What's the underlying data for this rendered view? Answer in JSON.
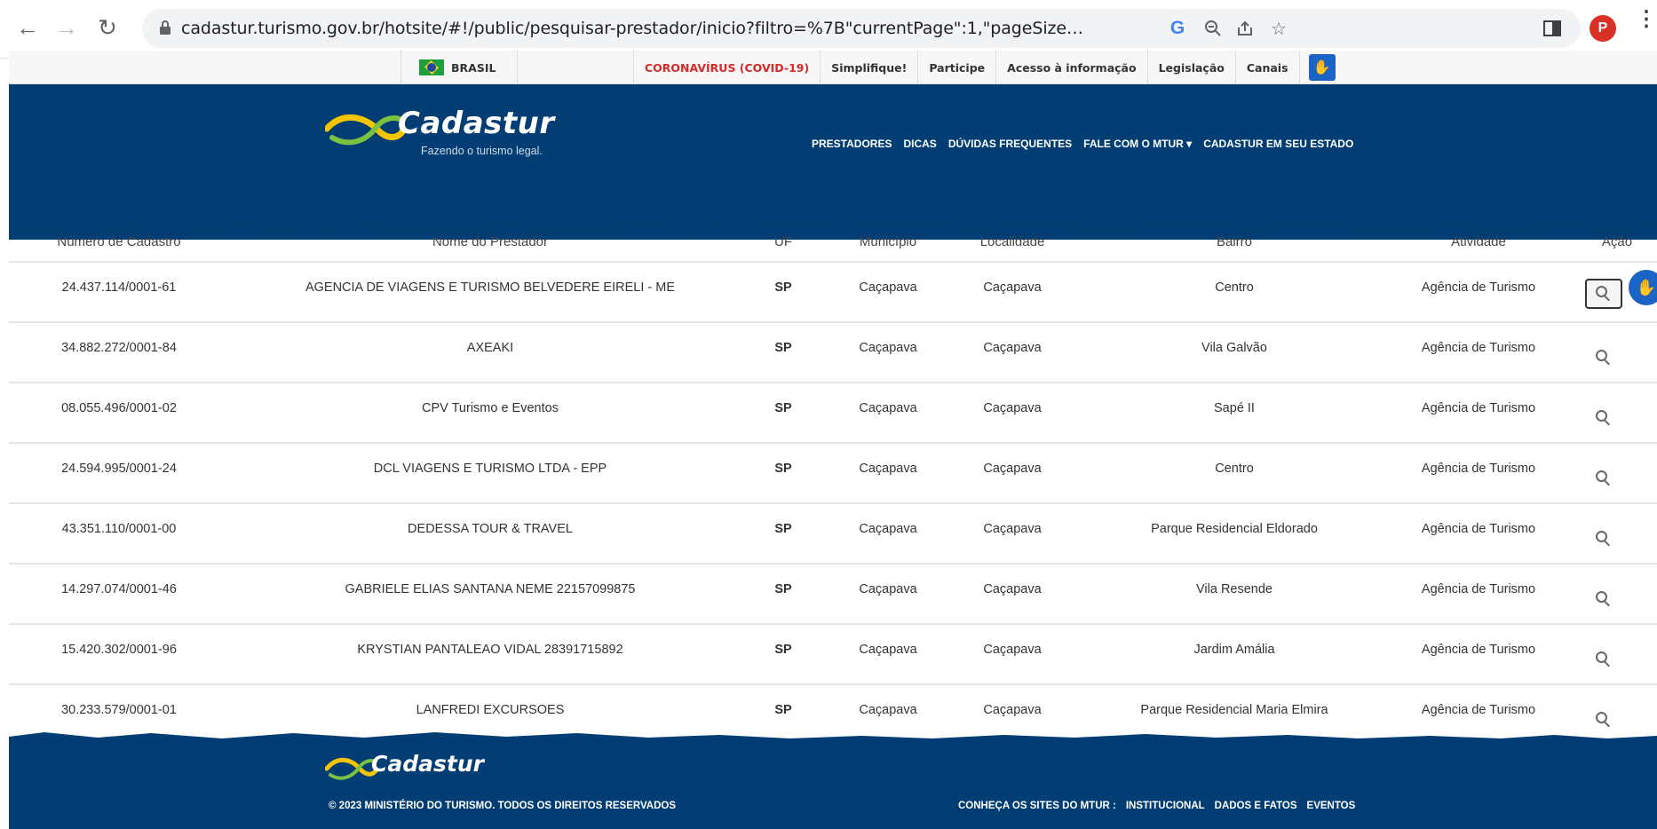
{
  "browser": {
    "url": "cadastur.turismo.gov.br/hotsite/#!/public/pesquisar-prestador/inicio?filtro=%7B\"currentPage\":1,\"pageSize\":10,\"sortFields\":\"nomePrestador\",\"sortDirections\":\"...",
    "profile_initial": "P",
    "icons": [
      "back-icon",
      "forward-icon",
      "reload-icon",
      "lock-icon",
      "google-icon",
      "zoom-icon",
      "share-icon",
      "star-icon",
      "side-panel-icon",
      "menu-icon"
    ]
  },
  "govbar": {
    "brasil": "BRASIL",
    "covid": "CORONAVÍRUS (COVID-19)",
    "simplifique": "Simplifique!",
    "participe": "Participe",
    "acesso": "Acesso à informação",
    "legislacao": "Legislação",
    "canais": "Canais"
  },
  "header": {
    "logo_word": "Cadastur",
    "tagline": "Fazendo o turismo legal.",
    "nav": [
      "PRESTADORES",
      "DICAS",
      "DÚVIDAS FREQUENTES",
      "FALE COM O MTUR ▾",
      "CADASTUR EM SEU ESTADO"
    ]
  },
  "table": {
    "headers": {
      "numero": "Número de Cadastro",
      "nome": "Nome do Prestador",
      "uf": "UF",
      "municipio": "Município",
      "localidade": "Localidade",
      "bairro": "Bairro",
      "atividade": "Atividade",
      "acao": "Ação"
    },
    "rows": [
      {
        "numero": "24.437.114/0001-61",
        "nome": "AGENCIA DE VIAGENS E TURISMO BELVEDERE EIRELI - ME",
        "uf": "SP",
        "municipio": "Caçapava",
        "localidade": "Caçapava",
        "bairro": "Centro",
        "atividade": "Agência de Turismo"
      },
      {
        "numero": "34.882.272/0001-84",
        "nome": "AXEAKI",
        "uf": "SP",
        "municipio": "Caçapava",
        "localidade": "Caçapava",
        "bairro": "Vila Galvão",
        "atividade": "Agência de Turismo"
      },
      {
        "numero": "08.055.496/0001-02",
        "nome": "CPV Turismo e Eventos",
        "uf": "SP",
        "municipio": "Caçapava",
        "localidade": "Caçapava",
        "bairro": "Sapé II",
        "atividade": "Agência de Turismo"
      },
      {
        "numero": "24.594.995/0001-24",
        "nome": "DCL VIAGENS E TURISMO LTDA - EPP",
        "uf": "SP",
        "municipio": "Caçapava",
        "localidade": "Caçapava",
        "bairro": "Centro",
        "atividade": "Agência de Turismo"
      },
      {
        "numero": "43.351.110/0001-00",
        "nome": "DEDESSA TOUR & TRAVEL",
        "uf": "SP",
        "municipio": "Caçapava",
        "localidade": "Caçapava",
        "bairro": "Parque Residencial Eldorado",
        "atividade": "Agência de Turismo"
      },
      {
        "numero": "14.297.074/0001-46",
        "nome": "GABRIELE ELIAS SANTANA NEME 22157099875",
        "uf": "SP",
        "municipio": "Caçapava",
        "localidade": "Caçapava",
        "bairro": "Vila Resende",
        "atividade": "Agência de Turismo"
      },
      {
        "numero": "15.420.302/0001-96",
        "nome": "KRYSTIAN PANTALEAO VIDAL 28391715892",
        "uf": "SP",
        "municipio": "Caçapava",
        "localidade": "Caçapava",
        "bairro": "Jardim Amália",
        "atividade": "Agência de Turismo"
      },
      {
        "numero": "30.233.579/0001-01",
        "nome": "LANFREDI EXCURSOES",
        "uf": "SP",
        "municipio": "Caçapava",
        "localidade": "Caçapava",
        "bairro": "Parque Residencial Maria Elmira",
        "atividade": "Agência de Turismo"
      }
    ]
  },
  "footer": {
    "logo_word": "Cadastur",
    "copyright": "© 2023 MINISTÉRIO DO TURISMO. TODOS OS DIREITOS RESERVADOS",
    "sites_label": "CONHEÇA OS SITES DO MTUR :",
    "sites": [
      "INSTITUCIONAL",
      "DADOS E FATOS",
      "EVENTOS"
    ]
  },
  "colors": {
    "brand_blue": "#023e73",
    "logo_yellow": "#f5c400",
    "logo_green": "#7cc242",
    "covid_red": "#d82828",
    "accent_blue": "#1b63c4"
  }
}
